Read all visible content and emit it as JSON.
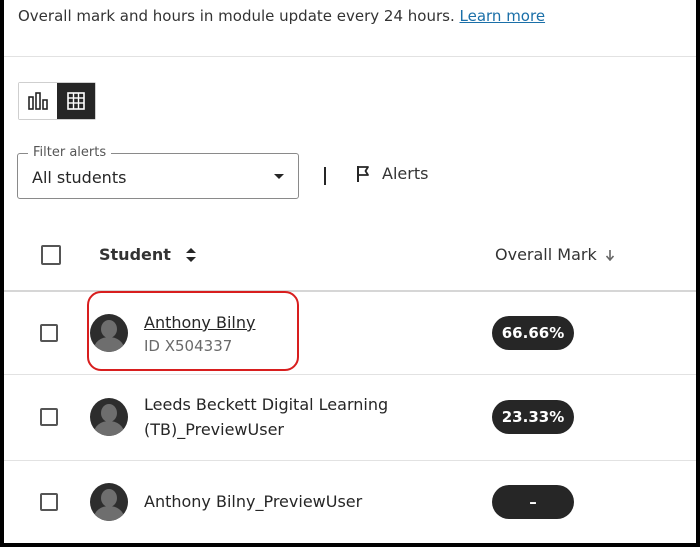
{
  "notice": {
    "text": "Overall mark and hours in module update every 24 hours.",
    "link": "Learn more"
  },
  "view_toggle": {
    "options": [
      {
        "icon": "bar-chart-icon",
        "active": false
      },
      {
        "icon": "table-grid-icon",
        "active": true
      }
    ]
  },
  "filter": {
    "label": "Filter alerts",
    "value": "All students",
    "icon": "chevron-down-icon"
  },
  "alerts": {
    "label": "Alerts",
    "icon": "flag-icon"
  },
  "table": {
    "headers": {
      "student": "Student",
      "student_sort_icon": "sort-icon",
      "overall_mark": "Overall Mark",
      "overall_mark_sort_icon": "arrow-down-icon"
    },
    "rows": [
      {
        "name": "Anthony Bilny",
        "id": "ID X504337",
        "mark": "66.66%",
        "highlighted": true
      },
      {
        "name_line1": "Leeds Beckett Digital Learning",
        "name_line2": "(TB)_PreviewUser",
        "mark": "23.33%"
      },
      {
        "name": "Anthony Bilny_PreviewUser",
        "mark": "–"
      }
    ]
  },
  "colors": {
    "accent_link": "#1a6fa8",
    "pill_bg": "#262626",
    "highlight": "#d81e1e"
  }
}
